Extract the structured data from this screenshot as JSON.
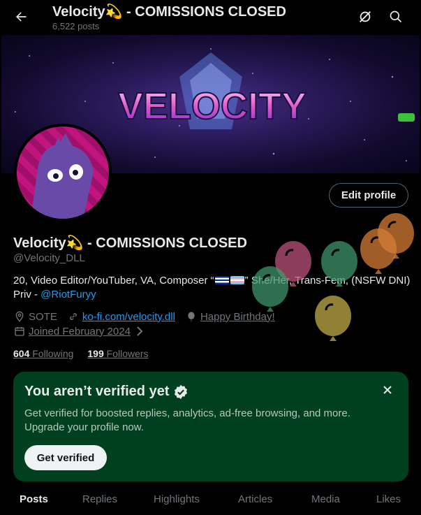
{
  "header": {
    "title": "Velocity💫 - COMISSIONS CLOSED",
    "post_count": "6,522 posts"
  },
  "banner": {
    "word": "VELOCITY"
  },
  "profile": {
    "edit_label": "Edit profile",
    "display_name": "Velocity💫 - COMISSIONS CLOSED",
    "handle": "@Velocity_DLL",
    "bio_prefix": "20, Video Editor/YouTuber, VA, Composer “",
    "bio_suffix": "” She/Her, Trans-Fem, (NSFW DNI) Priv - ",
    "bio_mention": "@RiotFuryy",
    "location": "SOTE",
    "website": "ko-fi.com/velocity.dll",
    "birthday": "Happy Birthday!",
    "joined": "Joined February 2024",
    "following_count": "604",
    "following_label": "Following",
    "followers_count": "199",
    "followers_label": "Followers"
  },
  "verify_card": {
    "title": "You aren’t verified yet",
    "body": "Get verified for boosted replies, analytics, ad-free browsing, and more. Upgrade your profile now.",
    "button": "Get verified",
    "background": "#00401f"
  },
  "tabs": [
    "Posts",
    "Replies",
    "Highlights",
    "Articles",
    "Media",
    "Likes"
  ],
  "colors": {
    "accent": "#1d9bf0",
    "muted": "#71767b",
    "text": "#e7e9ea"
  },
  "icons": [
    "back-arrow-icon",
    "grok-icon",
    "search-icon",
    "location-icon",
    "link-icon",
    "balloon-icon",
    "calendar-icon",
    "chevron-right-icon",
    "verified-badge-icon",
    "close-icon"
  ]
}
